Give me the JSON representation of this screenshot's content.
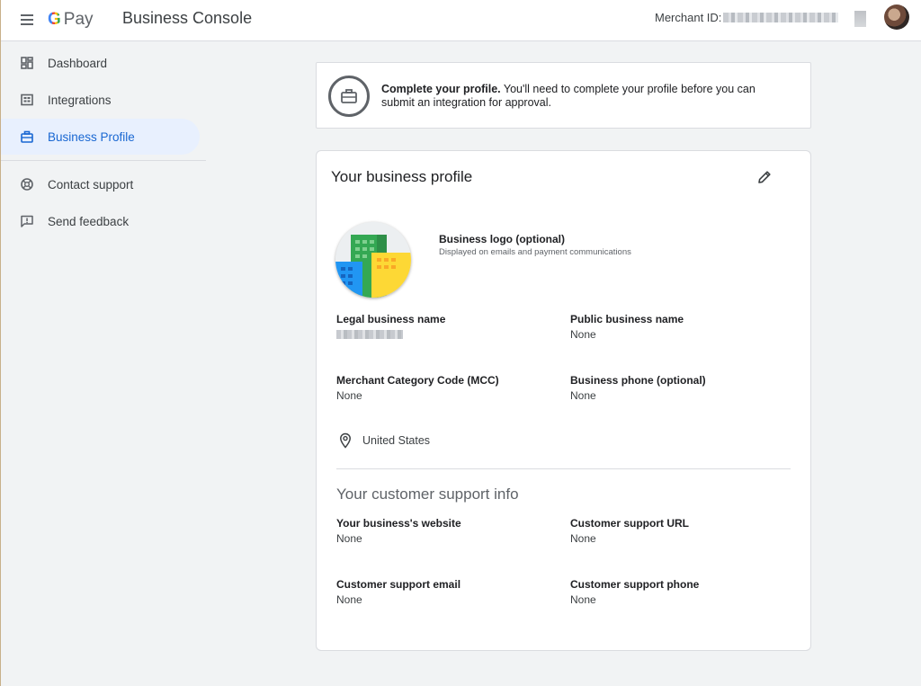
{
  "header": {
    "product_g": "G",
    "product_pay": "Pay",
    "app_title": "Business Console",
    "merchant_label": "Merchant ID:"
  },
  "sidebar": {
    "items": [
      {
        "label": "Dashboard",
        "icon": "dashboard-icon"
      },
      {
        "label": "Integrations",
        "icon": "integrations-icon"
      },
      {
        "label": "Business Profile",
        "icon": "briefcase-icon",
        "active": true
      },
      {
        "label": "Contact support",
        "icon": "support-icon"
      },
      {
        "label": "Send feedback",
        "icon": "feedback-icon"
      }
    ]
  },
  "banner": {
    "title": "Complete your profile.",
    "message": " You'll need to complete your profile before you can submit an integration for approval."
  },
  "profile": {
    "title": "Your business profile",
    "logo_label": "Business logo (optional)",
    "logo_sub": "Displayed on emails and payment communications",
    "legal_name_label": "Legal business name",
    "public_name_label": "Public business name",
    "public_name_value": "None",
    "mcc_label": "Merchant Category Code (MCC)",
    "mcc_value": "None",
    "phone_label": "Business phone (optional)",
    "phone_value": "None",
    "location": "United States"
  },
  "support": {
    "title": "Your customer support info",
    "website_label": "Your business's website",
    "website_value": "None",
    "url_label": "Customer support URL",
    "url_value": "None",
    "email_label": "Customer support email",
    "email_value": "None",
    "phone_label": "Customer support phone",
    "phone_value": "None"
  },
  "colors": {
    "accent": "#1967d2",
    "active_bg": "#e8f0fe",
    "page_bg": "#f1f3f4"
  }
}
